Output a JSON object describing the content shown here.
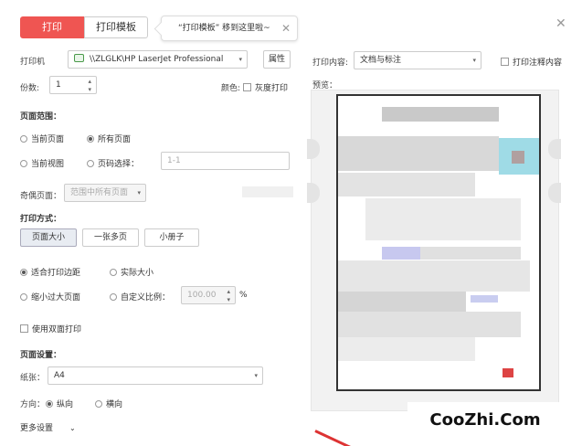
{
  "tabs": {
    "print": "打印",
    "template": "打印模板"
  },
  "tooltip": {
    "text": "“打印模板” 移到这里啦~",
    "close": "✕"
  },
  "window": {
    "close": "✕"
  },
  "printer": {
    "label": "打印机",
    "value": "\\\\ZLGLK\\HP LaserJet Professional",
    "properties": "属性"
  },
  "copies": {
    "label": "份数:",
    "value": "1",
    "color_label": "颜色:",
    "grayscale": "灰度打印"
  },
  "range": {
    "title": "页面范围：",
    "current_page": "当前页面",
    "all_pages": "所有页面",
    "current_view": "当前视图",
    "page_select": "页码选择：",
    "page_placeholder": "1-1",
    "odd_even_label": "奇偶页面：",
    "odd_even_value": "范围中所有页面"
  },
  "mode": {
    "title": "打印方式：",
    "buttons": [
      "页面大小",
      "一张多页",
      "小册子"
    ],
    "fit_margin": "适合打印边距",
    "actual_size": "实际大小",
    "shrink": "缩小过大页面",
    "custom_scale": "自定义比例：",
    "scale_value": "100.00",
    "percent": "%",
    "duplex": "使用双面打印"
  },
  "page_setup": {
    "title": "页面设置：",
    "paper_label": "纸张：",
    "paper_value": "A4",
    "orientation_label": "方向：",
    "portrait": "纵向",
    "landscape": "横向",
    "more": "更多设置"
  },
  "content": {
    "label": "打印内容:",
    "value": "文档与标注",
    "annotations": "打印注释内容"
  },
  "preview": {
    "label": "预览："
  },
  "watermark": "CooZhi.Com",
  "colors": {
    "accent": "#ef5552"
  }
}
